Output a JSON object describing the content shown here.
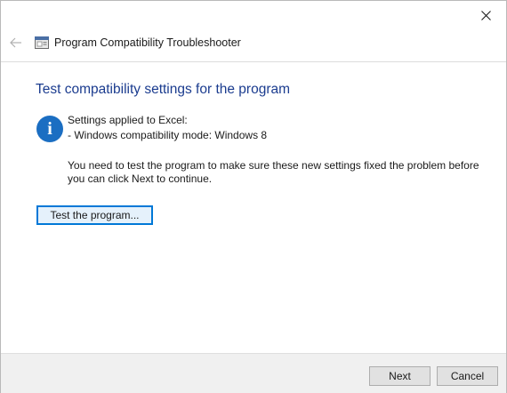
{
  "window": {
    "title": "Program Compatibility Troubleshooter",
    "close_icon": "close-icon",
    "back_icon": "back-arrow-icon"
  },
  "main": {
    "heading": "Test compatibility settings for the program",
    "info_icon": "info-icon",
    "info_glyph": "i",
    "applied_line": "Settings applied to Excel:",
    "mode_line": "- Windows compatibility mode: Windows 8",
    "instruction_line1": "You need to test the program to make sure these new settings fixed the problem before",
    "instruction_line2": "you can click Next to continue.",
    "test_button": "Test the program..."
  },
  "footer": {
    "next_label": "Next",
    "cancel_label": "Cancel"
  },
  "colors": {
    "heading": "#1b3c8f",
    "info_icon": "#1b6ec2",
    "focus_border": "#0078d7"
  }
}
